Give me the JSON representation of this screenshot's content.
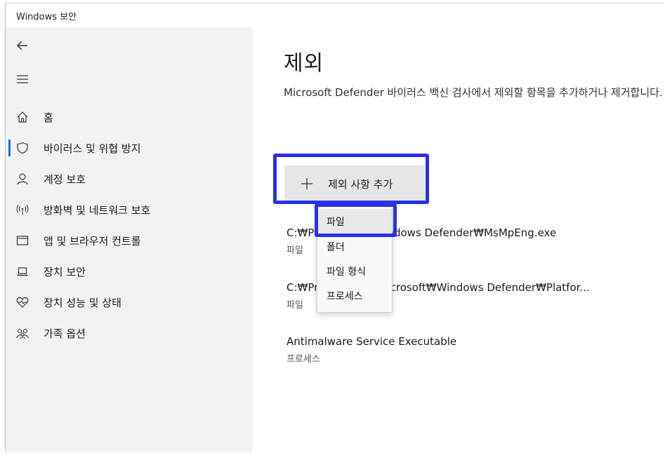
{
  "window": {
    "title": "Windows 보안"
  },
  "sidebar": {
    "back_icon": "arrow-left-icon",
    "menu_icon": "hamburger-icon",
    "items": [
      {
        "label": "홈",
        "icon": "home-icon"
      },
      {
        "label": "바이러스 및 위협 방지",
        "icon": "shield-icon",
        "selected": true
      },
      {
        "label": "계정 보호",
        "icon": "person-icon"
      },
      {
        "label": "방화벽 및 네트워크 보호",
        "icon": "wifi-antenna-icon"
      },
      {
        "label": "앱 및 브라우저 컨트롤",
        "icon": "browser-window-icon"
      },
      {
        "label": "장치 보안",
        "icon": "laptop-icon"
      },
      {
        "label": "장치 성능 및 상태",
        "icon": "heart-pulse-icon"
      },
      {
        "label": "가족 옵션",
        "icon": "family-icon"
      }
    ]
  },
  "main": {
    "title": "제외",
    "description": "Microsoft Defender 바이러스 백신 검사에서 제외할 항목을 추가하거나 제거합니다.",
    "add_button_label": "제외 사항 추가",
    "exclusions": [
      {
        "path": "C:₩Pr",
        "path_tail": "indows Defender₩MsMpEng.exe",
        "type": "파일"
      },
      {
        "path": "C:₩Pr",
        "path_tail": "licrosoft₩Windows Defender₩Platfor...",
        "type": "파일"
      },
      {
        "path": "Antimalware Service Executable",
        "path_tail": "",
        "type": "프로세스"
      }
    ]
  },
  "dropdown": {
    "options": [
      "파일",
      "폴더",
      "파일 형식",
      "프로세스"
    ],
    "hovered": "파일"
  },
  "colors": {
    "accent": "#0078d4",
    "highlight_box": "#2b30e6",
    "sidebar_bg": "#f2f2f2",
    "button_bg": "#e6e6e6"
  }
}
